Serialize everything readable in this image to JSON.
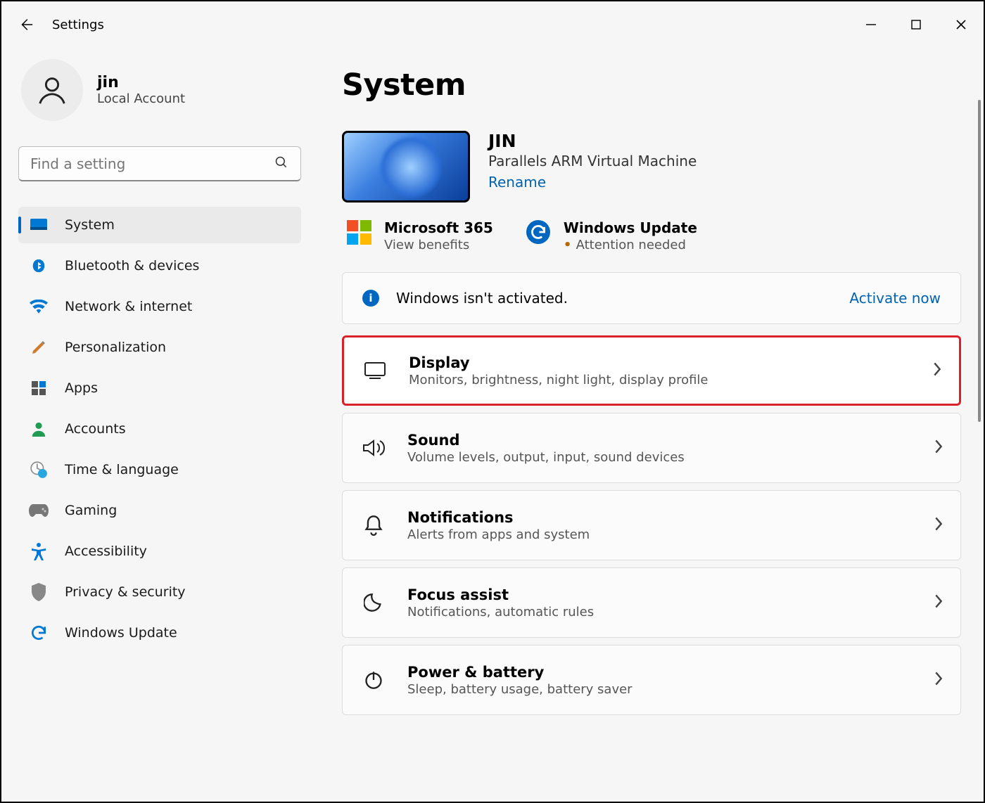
{
  "window": {
    "title": "Settings"
  },
  "profile": {
    "name": "jin",
    "account_type": "Local Account"
  },
  "search": {
    "placeholder": "Find a setting"
  },
  "nav": {
    "items": [
      {
        "label": "System"
      },
      {
        "label": "Bluetooth & devices"
      },
      {
        "label": "Network & internet"
      },
      {
        "label": "Personalization"
      },
      {
        "label": "Apps"
      },
      {
        "label": "Accounts"
      },
      {
        "label": "Time & language"
      },
      {
        "label": "Gaming"
      },
      {
        "label": "Accessibility"
      },
      {
        "label": "Privacy & security"
      },
      {
        "label": "Windows Update"
      }
    ]
  },
  "page": {
    "title": "System",
    "pc": {
      "name": "JIN",
      "desc": "Parallels ARM Virtual Machine",
      "rename": "Rename"
    },
    "tiles": {
      "m365": {
        "title": "Microsoft 365",
        "sub": "View benefits"
      },
      "wu": {
        "title": "Windows Update",
        "sub": "Attention needed"
      }
    },
    "banner": {
      "text": "Windows isn't activated.",
      "link": "Activate now"
    },
    "cards": [
      {
        "title": "Display",
        "sub": "Monitors, brightness, night light, display profile"
      },
      {
        "title": "Sound",
        "sub": "Volume levels, output, input, sound devices"
      },
      {
        "title": "Notifications",
        "sub": "Alerts from apps and system"
      },
      {
        "title": "Focus assist",
        "sub": "Notifications, automatic rules"
      },
      {
        "title": "Power & battery",
        "sub": "Sleep, battery usage, battery saver"
      }
    ]
  }
}
